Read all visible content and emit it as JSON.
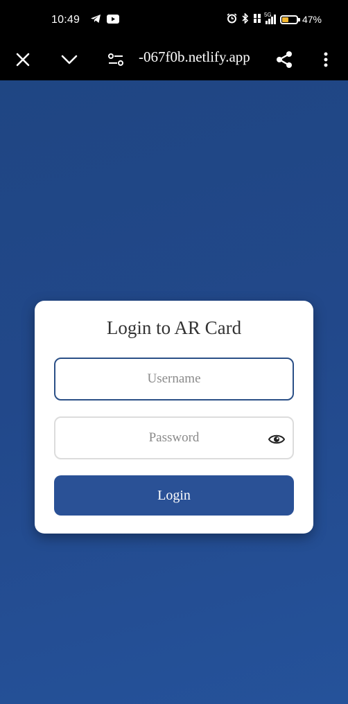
{
  "status_bar": {
    "time": "10:49",
    "battery_percent_label": "47%",
    "battery_level": 0.47,
    "network_label": "5G"
  },
  "browser": {
    "url": "-067f0b.netlify.app",
    "icons": [
      "close-icon",
      "chevron-down-icon",
      "site-settings-icon",
      "share-icon",
      "more-vert-icon"
    ]
  },
  "login": {
    "title": "Login to AR Card",
    "username_placeholder": "Username",
    "username_value": "",
    "password_placeholder": "Password",
    "password_value": "",
    "button_label": "Login"
  },
  "colors": {
    "page_background": "#22488a",
    "button": "#2a5196",
    "focus_border": "#2a4f86"
  }
}
